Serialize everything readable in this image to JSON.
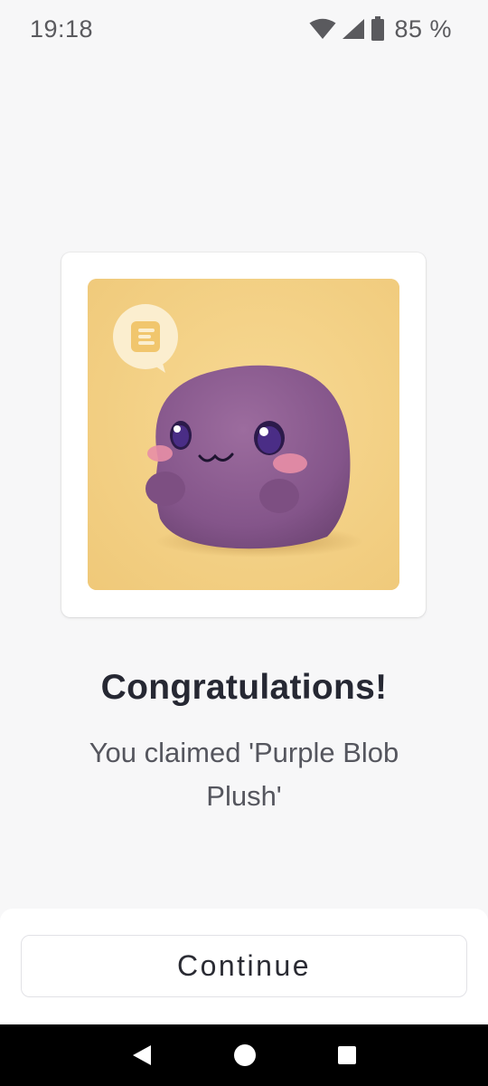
{
  "status_bar": {
    "time": "19:18",
    "battery": "85 %",
    "icons": [
      "wifi-icon",
      "signal-icon",
      "battery-icon"
    ]
  },
  "reward": {
    "image_alt": "Purple Blob Plush",
    "title": "Congratulations!",
    "message": "You claimed 'Purple Blob Plush'"
  },
  "actions": {
    "continue_label": "Continue"
  },
  "nav_bar": {
    "icons": [
      "back-icon",
      "home-icon",
      "recents-icon"
    ]
  },
  "colors": {
    "background": "#f7f7f8",
    "image_background": "#f4d185",
    "plush": "#8a5a8c",
    "text_primary": "#262833",
    "text_secondary": "#55565e"
  }
}
